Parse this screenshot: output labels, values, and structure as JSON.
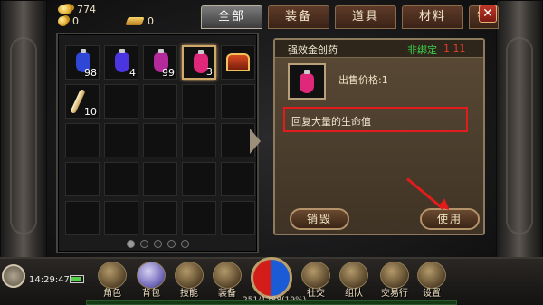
{
  "currency": {
    "gold": "774",
    "coins": "0",
    "bars": "0"
  },
  "tabs": [
    {
      "label": "全部",
      "active": true
    },
    {
      "label": "装备",
      "active": false
    },
    {
      "label": "道具",
      "active": false
    },
    {
      "label": "材料",
      "active": false
    },
    {
      "label": "销",
      "active": false
    }
  ],
  "close_label": "✕",
  "inventory": {
    "items": [
      {
        "icon": "blue-potion-icon",
        "qty": "98",
        "color": "#2f47d6"
      },
      {
        "icon": "violet-potion-icon",
        "qty": "4",
        "color": "#4b35e0"
      },
      {
        "icon": "purple-potion-icon",
        "qty": "99",
        "color": "#b42a9b"
      },
      {
        "icon": "red-potion-icon",
        "qty": "3",
        "color": "#e0287a",
        "selected": true
      },
      {
        "icon": "treasure-chest-icon",
        "qty": ""
      },
      {
        "icon": "dagger-icon",
        "qty": "10"
      }
    ],
    "pages": 5,
    "current_page": 1
  },
  "detail": {
    "item_name": "强效金创药",
    "bind_status": "非绑定",
    "level_req": "1 11",
    "price": "出售价格:1",
    "description": "回复大量的生命值",
    "destroy_label": "销毁",
    "use_label": "使用"
  },
  "status": {
    "time": "14:29:47",
    "hp_text": "251/1288(19%)"
  },
  "menu": [
    {
      "label": "角色",
      "icon": "character-icon"
    },
    {
      "label": "背包",
      "icon": "backpack-icon"
    },
    {
      "label": "技能",
      "icon": "skill-book-icon"
    },
    {
      "label": "装备",
      "icon": "equipment-icon"
    },
    {
      "label": "社交",
      "icon": "social-icon"
    },
    {
      "label": "组队",
      "icon": "team-icon"
    },
    {
      "label": "交易行",
      "icon": "trade-icon"
    },
    {
      "label": "设置",
      "icon": "settings-gear-icon"
    }
  ],
  "colors": {
    "accent_gold": "#d1a96b",
    "bind_green": "#3bd04a",
    "highlight_red": "#e21c1c"
  }
}
